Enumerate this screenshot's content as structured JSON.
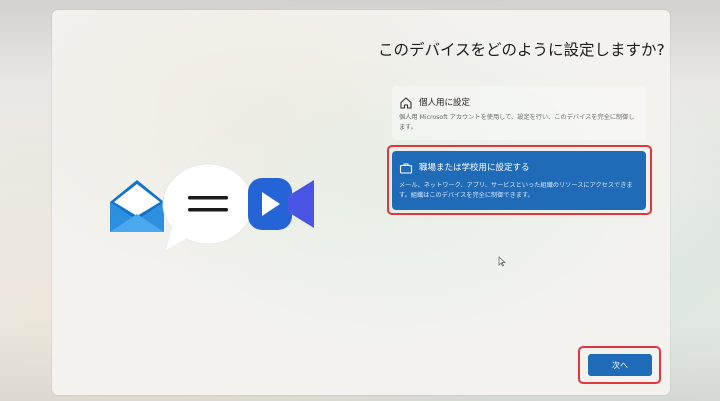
{
  "title": "このデバイスをどのように設定しますか?",
  "options": [
    {
      "label": "個人用に設定",
      "description": "個人用 Microsoft アカウントを使用して、設定を行い、このデバイスを完全に制御します。",
      "icon": "home-icon",
      "selected": false
    },
    {
      "label": "職場または学校用に設定する",
      "description": "メール、ネットワーク、アプリ、サービスといった組織のリソースにアクセスできます。組織はこのデバイスを完全に制御できます。",
      "icon": "briefcase-icon",
      "selected": true
    }
  ],
  "next_button": {
    "label": "次へ"
  },
  "illustration": {
    "icons": [
      "mail-envelope-icon",
      "chat-bubble-icon",
      "video-camera-icon"
    ]
  },
  "colors": {
    "accent": "#1f6bb8",
    "highlight": "#e0363c"
  }
}
